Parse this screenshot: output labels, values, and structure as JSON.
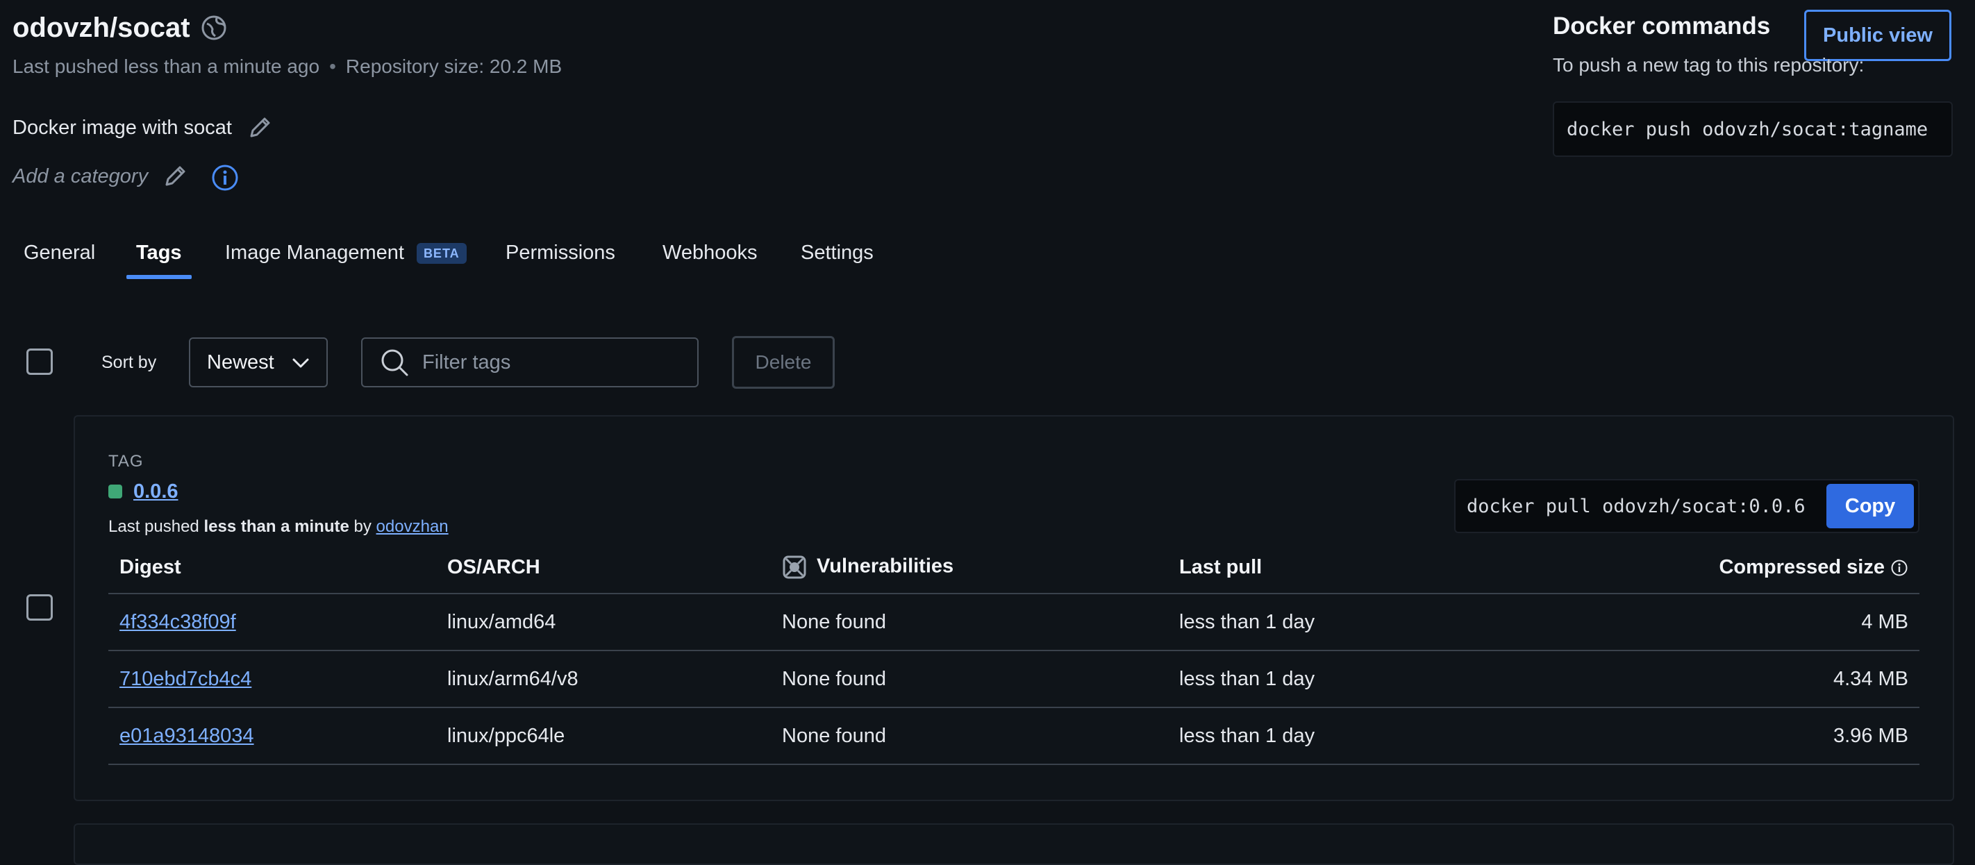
{
  "repo": {
    "title": "odovzh/socat",
    "last_pushed": "Last pushed less than a minute ago",
    "size": "Repository size: 20.2 MB",
    "description": "Docker image with socat",
    "add_category": "Add a category"
  },
  "tabs": [
    {
      "label": "General"
    },
    {
      "label": "Tags",
      "active": true
    },
    {
      "label": "Image Management",
      "badge": "BETA"
    },
    {
      "label": "Permissions"
    },
    {
      "label": "Webhooks"
    },
    {
      "label": "Settings"
    }
  ],
  "docker_commands": {
    "title": "Docker commands",
    "public_view": "Public view",
    "push_hint": "To push a new tag to this repository:",
    "push_command": "docker push odovzh/socat:tagname"
  },
  "toolbar": {
    "sort_label": "Sort by",
    "sort_value": "Newest",
    "filter_placeholder": "Filter tags",
    "delete_label": "Delete"
  },
  "tag": {
    "section_label": "TAG",
    "name": "0.0.6",
    "pushed_prefix": "Last pushed",
    "pushed_when": "less than a minute",
    "pushed_by_word": "by",
    "pushed_by": "odovzhan",
    "pull_command": "docker pull odovzh/socat:0.0.6",
    "copy_label": "Copy",
    "status_color": "#3fa776"
  },
  "table": {
    "headers": {
      "digest": "Digest",
      "os_arch": "OS/ARCH",
      "vulnerabilities": "Vulnerabilities",
      "last_pull": "Last pull",
      "compressed_size": "Compressed size"
    },
    "rows": [
      {
        "digest": "4f334c38f09f",
        "os_arch": "linux/amd64",
        "vulnerabilities": "None found",
        "last_pull": "less than 1 day",
        "size": "4 MB"
      },
      {
        "digest": "710ebd7cb4c4",
        "os_arch": "linux/arm64/v8",
        "vulnerabilities": "None found",
        "last_pull": "less than 1 day",
        "size": "4.34 MB"
      },
      {
        "digest": "e01a93148034",
        "os_arch": "linux/ppc64le",
        "vulnerabilities": "None found",
        "last_pull": "less than 1 day",
        "size": "3.96 MB"
      }
    ]
  },
  "colors": {
    "accent": "#4a8cf7",
    "background": "#0e1217",
    "link": "#7eb0ff"
  }
}
